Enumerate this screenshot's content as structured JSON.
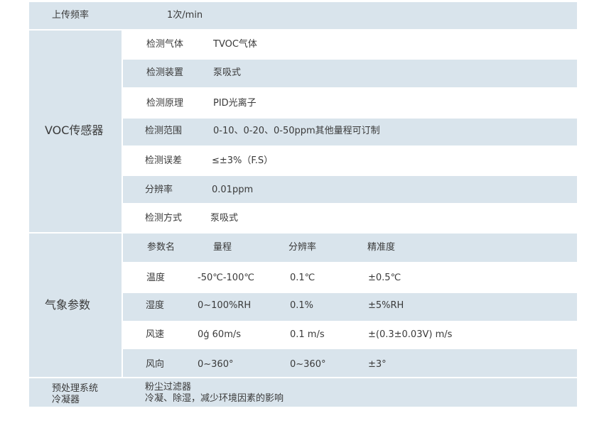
{
  "upload": {
    "label": "上传频率",
    "value": "1次/min"
  },
  "voc": {
    "title": "VOC传感器",
    "rows": [
      {
        "label": "检测气体",
        "value": "TVOC气体"
      },
      {
        "label": "检测装置",
        "value": "泵吸式"
      },
      {
        "label": "检测原理",
        "value": "PID光离子"
      },
      {
        "label": "检测范围",
        "value": "0-10、0-20、0-50ppm其他量程可订制"
      },
      {
        "label": "检测误差",
        "value": "≤±3%（F.S）"
      },
      {
        "label": "分辨率",
        "value": "0.01ppm"
      },
      {
        "label": "检测方式",
        "value": "泵吸式"
      }
    ]
  },
  "weather": {
    "title": "气象参数",
    "header": [
      "参数名",
      "量程",
      "分辨率",
      "精准度"
    ],
    "rows": [
      [
        "温度",
        "-50℃-100℃",
        "0.1℃",
        "±0.5℃"
      ],
      [
        "湿度",
        "0~100%RH",
        "0.1%",
        "±5%RH"
      ],
      [
        "风速",
        "0ģ 60m/s",
        "0.1 m/s",
        "±(0.3±0.03V) m/s"
      ],
      [
        "风向",
        "0~360°",
        "0~360°",
        "±3°"
      ]
    ]
  },
  "pretreat": {
    "label_line1": "预处理系统",
    "label_line2": "冷凝器",
    "value_line1": "粉尘过滤器",
    "value_line2": "冷凝、除湿，减少环境因素的影响"
  }
}
